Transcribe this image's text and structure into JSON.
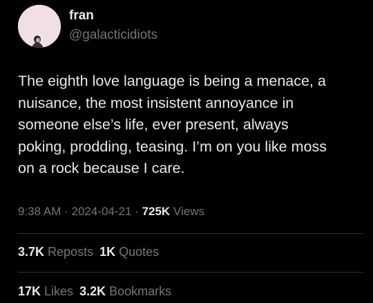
{
  "user": {
    "display_name": "fran",
    "handle": "@galacticidiots"
  },
  "tweet": {
    "lines": [
      "The eighth love language is being a menace, a",
      "nuisance, the most insistent annoyance in",
      "someone else’s life, ever present, always",
      "poking, prodding, teasing. I’m on you like moss",
      "on a rock because I care."
    ]
  },
  "meta": {
    "time": "9:38 AM",
    "sep1": " · ",
    "date": "2024-04-21",
    "sep2": " · ",
    "views_count": "725K",
    "views_label": " Views"
  },
  "stats": {
    "reposts_count": "3.7K",
    "reposts_label": " Reposts",
    "quotes_count": "1K",
    "quotes_label": " Quotes",
    "likes_count": "17K",
    "likes_label": " Likes",
    "bookmarks_count": "3.2K",
    "bookmarks_label": " Bookmarks"
  },
  "colors": {
    "background": "#000000",
    "text_primary": "#e7e9ea",
    "text_secondary": "#71767b",
    "divider": "#2f3336",
    "avatar_bg": "#f1dfe6"
  }
}
